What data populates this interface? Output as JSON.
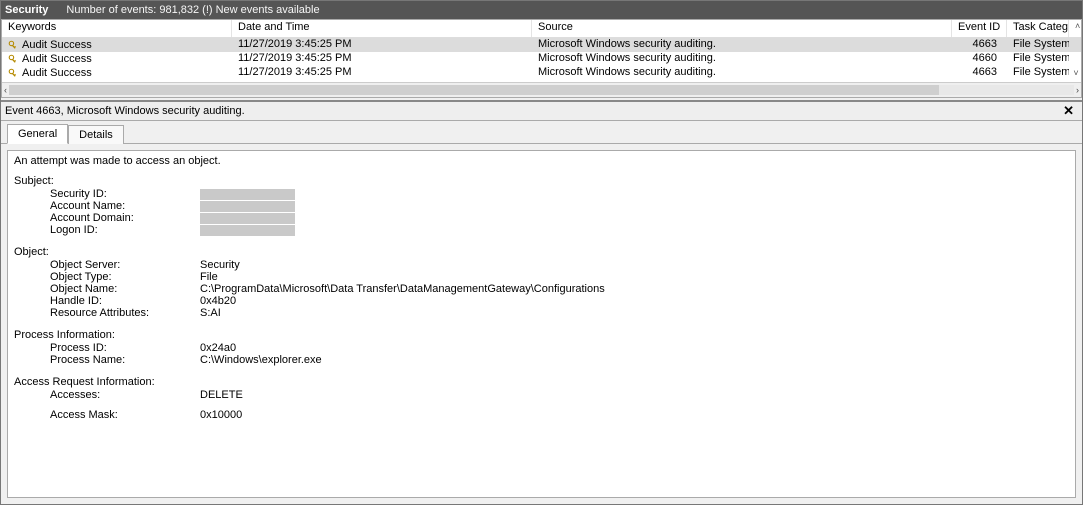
{
  "titlebar": {
    "log_name": "Security",
    "event_count_label": "Number of events: 981,832 (!) New events available"
  },
  "columns": {
    "keywords": "Keywords",
    "datetime": "Date and Time",
    "source": "Source",
    "event_id": "Event ID",
    "task_category": "Task Category"
  },
  "rows": [
    {
      "keywords": "Audit Success",
      "datetime": "11/27/2019 3:45:25 PM",
      "source": "Microsoft Windows security auditing.",
      "event_id": "4663",
      "task_category": "File System",
      "selected": true
    },
    {
      "keywords": "Audit Success",
      "datetime": "11/27/2019 3:45:25 PM",
      "source": "Microsoft Windows security auditing.",
      "event_id": "4660",
      "task_category": "File System",
      "selected": false
    },
    {
      "keywords": "Audit Success",
      "datetime": "11/27/2019 3:45:25 PM",
      "source": "Microsoft Windows security auditing.",
      "event_id": "4663",
      "task_category": "File System",
      "selected": false
    }
  ],
  "details": {
    "header": "Event 4663, Microsoft Windows security auditing.",
    "tabs": {
      "general": "General",
      "details": "Details"
    },
    "message": "An attempt was made to access an object.",
    "subject": {
      "title": "Subject:",
      "security_id_label": "Security ID:",
      "account_name_label": "Account Name:",
      "account_domain_label": "Account Domain:",
      "logon_id_label": "Logon ID:"
    },
    "object": {
      "title": "Object:",
      "object_server_label": "Object Server:",
      "object_server_value": "Security",
      "object_type_label": "Object Type:",
      "object_type_value": "File",
      "object_name_label": "Object Name:",
      "object_name_value": "C:\\ProgramData\\Microsoft\\Data Transfer\\DataManagementGateway\\Configurations",
      "handle_id_label": "Handle ID:",
      "handle_id_value": "0x4b20",
      "resource_attr_label": "Resource Attributes:",
      "resource_attr_value": "S:AI"
    },
    "process": {
      "title": "Process Information:",
      "process_id_label": "Process ID:",
      "process_id_value": "0x24a0",
      "process_name_label": "Process Name:",
      "process_name_value": "C:\\Windows\\explorer.exe"
    },
    "access": {
      "title": "Access Request Information:",
      "accesses_label": "Accesses:",
      "accesses_value": "DELETE",
      "access_mask_label": "Access Mask:",
      "access_mask_value": "0x10000"
    }
  },
  "glyphs": {
    "close": "✕",
    "left": "‹",
    "right": "›",
    "up": "˄",
    "down": "˅"
  }
}
